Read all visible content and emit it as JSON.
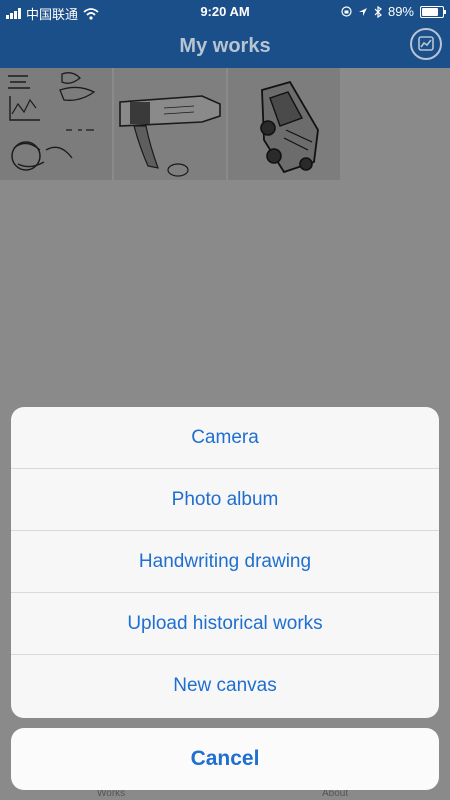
{
  "status_bar": {
    "carrier": "中国联通",
    "time": "9:20 AM",
    "battery": "89%",
    "battery_level": 0.89,
    "icons": [
      "signal-icon",
      "wifi-icon",
      "orientation-lock-icon",
      "location-icon",
      "bluetooth-icon",
      "battery-icon"
    ]
  },
  "nav": {
    "title": "My works",
    "right_icon": "chart-icon"
  },
  "gallery": {
    "items": [
      {
        "kind": "back-to-school-sketch"
      },
      {
        "kind": "bottle-sketch"
      },
      {
        "kind": "car-sketch"
      }
    ]
  },
  "action_sheet": {
    "items": [
      {
        "label": "Camera"
      },
      {
        "label": "Photo album"
      },
      {
        "label": "Handwriting drawing"
      },
      {
        "label": "Upload historical works"
      },
      {
        "label": "New canvas"
      }
    ],
    "cancel_label": "Cancel"
  },
  "tabs": {
    "works_label": "Works",
    "about_label": "About"
  },
  "colors": {
    "nav_background": "#1a4f8a",
    "action_text": "#1f6fd0",
    "overlay": "#8a8a8a"
  }
}
